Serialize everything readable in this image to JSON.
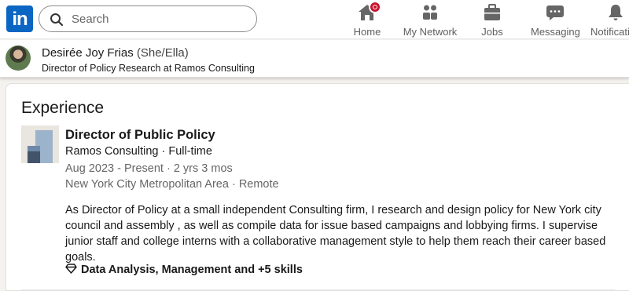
{
  "nav": {
    "logo_text": "in",
    "search_placeholder": "Search",
    "items": [
      {
        "label": "Home",
        "icon": "home-icon",
        "has_badge": true
      },
      {
        "label": "My Network",
        "icon": "network-icon"
      },
      {
        "label": "Jobs",
        "icon": "briefcase-icon"
      },
      {
        "label": "Messaging",
        "icon": "message-icon"
      },
      {
        "label": "Notificati",
        "icon": "bell-icon"
      }
    ]
  },
  "profile": {
    "name": "Desirée Joy Frias",
    "pronouns": "(She/Ella)",
    "headline": "Director of Policy Research at Ramos Consulting"
  },
  "experience": {
    "section_title": "Experience",
    "role": "Director of Public Policy",
    "company_line": "Ramos Consulting · Full-time",
    "dates": "Aug 2023 - Present · 2 yrs 3 mos",
    "location": "New York City Metropolitan Area · Remote",
    "description": "As Director of Policy at a small independent Consulting firm, I research and design policy for New York city council and assembly , as well as compile data for issue based campaigns and lobbying firms. I supervise junior staff and college interns with a collaborative management style to help them reach their career based goals.",
    "skills": "Data Analysis, Management and +5 skills"
  },
  "colors": {
    "brand": "#0a66c2",
    "badge": "#cb112d",
    "background": "#f4f2ee"
  }
}
